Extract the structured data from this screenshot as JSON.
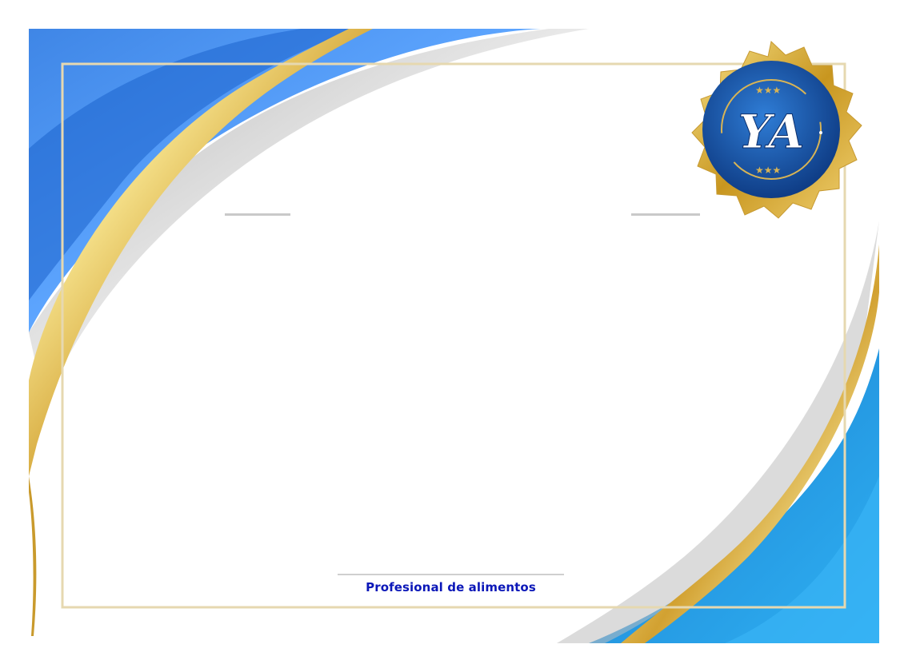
{
  "certificate": {
    "signature_caption": "Profesional de alimentos"
  },
  "seal": {
    "logo_text": "YA",
    "icon": "ya-seal-logo-icon"
  },
  "colors": {
    "blue_dark": "#1d6fd6",
    "blue_light": "#5aa3ff",
    "cyan": "#2aa8ea",
    "gold": "#d4a537",
    "gold_light": "#f4e08a",
    "seal_blue": "#1a56a8",
    "caption_blue": "#0b17b8"
  }
}
